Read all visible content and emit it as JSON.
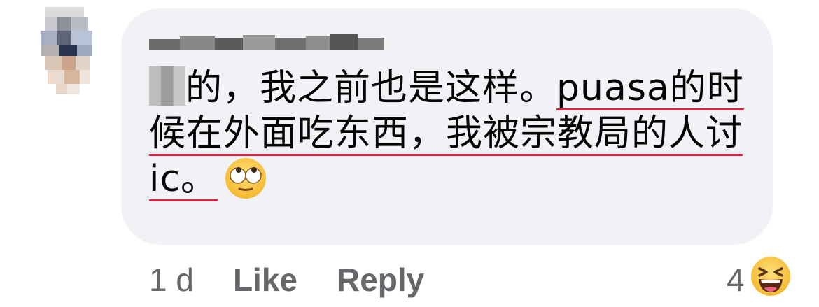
{
  "comment": {
    "author_obscured": true,
    "text_prefix": "的，我之前也是这样。",
    "text_underlined": "puasa的时候在外面吃东西，我被宗教局的人讨 ic。",
    "emoji": "rolling-eyes-emoji"
  },
  "actions": {
    "time": "1 d",
    "like_label": "Like",
    "reply_label": "Reply"
  },
  "reactions": {
    "count": "4",
    "icon": "laughing-emoji"
  },
  "colors": {
    "bubble": "#f0f2f5",
    "text": "#050505",
    "meta": "#65676b",
    "underline": "#e41e3f"
  }
}
